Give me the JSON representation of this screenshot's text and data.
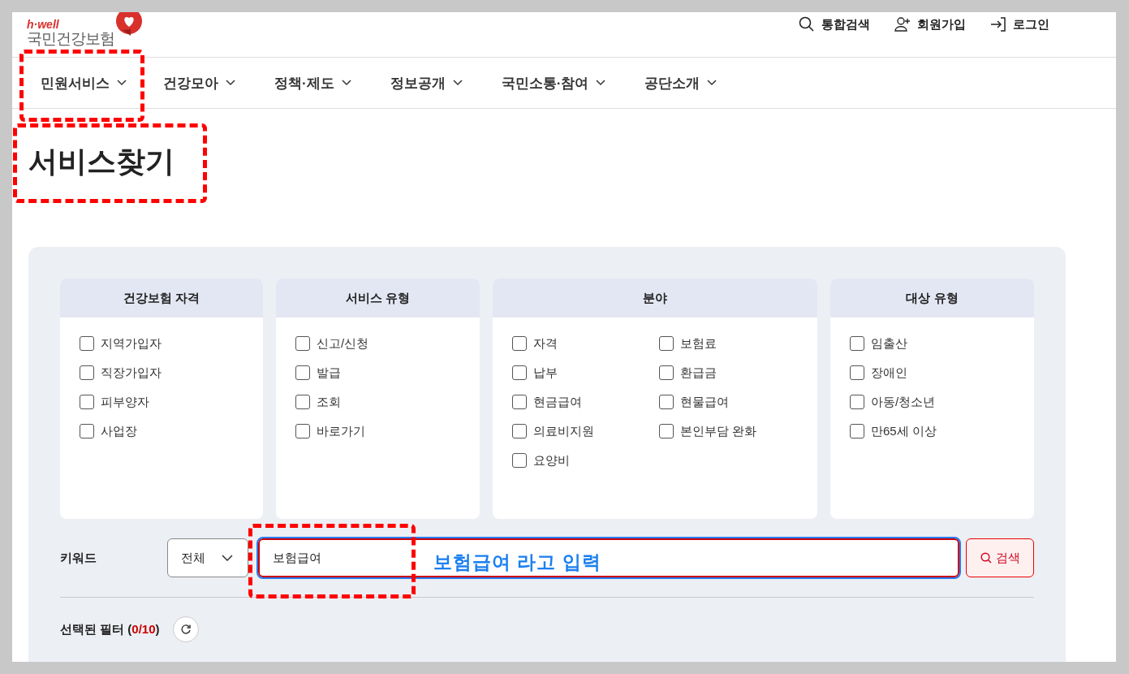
{
  "header": {
    "logo": {
      "tagline": "h·well",
      "name": "국민건강보험"
    },
    "utility_links": [
      {
        "kind": "search",
        "label": "통합검색"
      },
      {
        "kind": "signup",
        "label": "회원가입"
      },
      {
        "kind": "login",
        "label": "로그인"
      }
    ]
  },
  "nav": {
    "items": [
      {
        "label": "민원서비스",
        "highlighted": true
      },
      {
        "label": "건강모아",
        "highlighted": false
      },
      {
        "label": "정책·제도",
        "highlighted": false
      },
      {
        "label": "정보공개",
        "highlighted": false
      },
      {
        "label": "국민소통·참여",
        "highlighted": false
      },
      {
        "label": "공단소개",
        "highlighted": false
      }
    ]
  },
  "page_title": {
    "text": "서비스찾기",
    "highlighted": true
  },
  "filters": {
    "groups": [
      {
        "title": "건강보험 자격",
        "kind": "single",
        "options": [
          {
            "label": "지역가입자",
            "checked": false
          },
          {
            "label": "직장가입자",
            "checked": false
          },
          {
            "label": "피부양자",
            "checked": false
          },
          {
            "label": "사업장",
            "checked": false
          }
        ]
      },
      {
        "title": "서비스 유형",
        "kind": "single",
        "options": [
          {
            "label": "신고/신청",
            "checked": false
          },
          {
            "label": "발급",
            "checked": false
          },
          {
            "label": "조회",
            "checked": false
          },
          {
            "label": "바로가기",
            "checked": false
          }
        ]
      },
      {
        "title": "분야",
        "kind": "double",
        "options": [
          {
            "label": "자격",
            "checked": false
          },
          {
            "label": "보험료",
            "checked": false
          },
          {
            "label": "납부",
            "checked": false
          },
          {
            "label": "환급금",
            "checked": false
          },
          {
            "label": "현금급여",
            "checked": false
          },
          {
            "label": "현물급여",
            "checked": false
          },
          {
            "label": "의료비지원",
            "checked": false
          },
          {
            "label": "본인부담 완화",
            "checked": false
          },
          {
            "label": "요양비",
            "checked": false
          }
        ]
      },
      {
        "title": "대상 유형",
        "kind": "single",
        "options": [
          {
            "label": "임출산",
            "checked": false
          },
          {
            "label": "장애인",
            "checked": false
          },
          {
            "label": "아동/청소년",
            "checked": false
          },
          {
            "label": "만65세 이상",
            "checked": false
          }
        ]
      }
    ],
    "keyword": {
      "label": "키워드",
      "scope": "전체",
      "value": "보험급여",
      "highlighted": true,
      "note": "보험급여  라고 입력",
      "button": "검색"
    },
    "selected": {
      "label": "선택된 필터 (",
      "count": "0/10",
      "close": ")"
    }
  }
}
